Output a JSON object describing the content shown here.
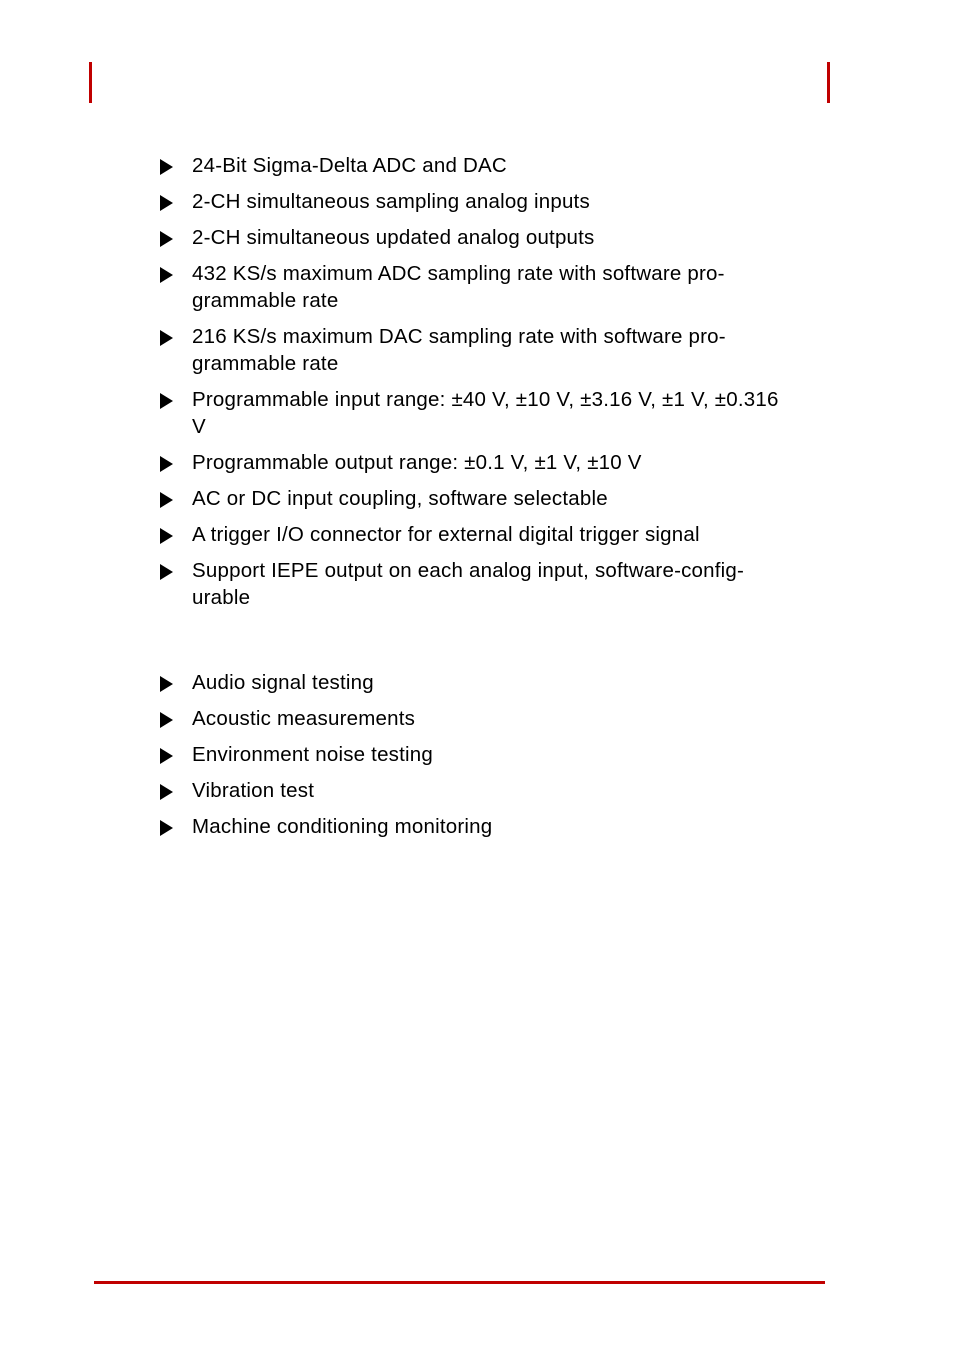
{
  "page": {
    "background_color": "#ffffff",
    "accent_color": "#c00000",
    "text_color": "#000000"
  },
  "header": {
    "crop_mark_left_name": "crop-mark-left",
    "crop_mark_right_name": "crop-mark-right"
  },
  "features": {
    "bullet_glyph": "triangle-right",
    "items": [
      {
        "text": "24-Bit Sigma-Delta ADC and DAC"
      },
      {
        "text": "2-CH simultaneous sampling analog inputs"
      },
      {
        "text": "2-CH simultaneous updated analog outputs"
      },
      {
        "text": "432 KS/s maximum ADC sampling rate with software pro-grammable rate"
      },
      {
        "text": "216 KS/s maximum DAC sampling rate with software pro-grammable rate"
      },
      {
        "text": "Programmable input range: ±40 V, ±10 V, ±3.16 V, ±1 V, ±0.316 V"
      },
      {
        "text": "Programmable output range: ±0.1 V, ±1 V, ±10 V"
      },
      {
        "text": "AC or DC input coupling, software selectable"
      },
      {
        "text": "A trigger I/O connector for external digital trigger signal"
      },
      {
        "text": "Support IEPE output on each analog input, software-config-urable"
      }
    ]
  },
  "applications": {
    "bullet_glyph": "triangle-right",
    "items": [
      {
        "text": "Audio signal testing"
      },
      {
        "text": "Acoustic measurements"
      },
      {
        "text": "Environment noise testing"
      },
      {
        "text": "Vibration test"
      },
      {
        "text": "Machine conditioning monitoring"
      }
    ]
  },
  "footer": {
    "rule_color": "#c00000"
  }
}
